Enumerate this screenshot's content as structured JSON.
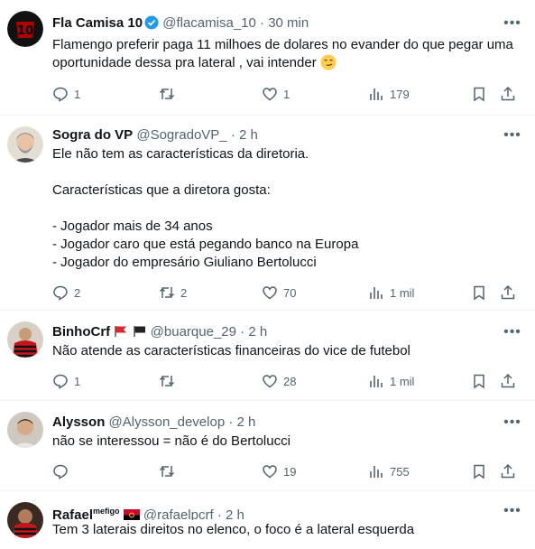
{
  "tweets": [
    {
      "name": "Fla Camisa 10",
      "handle": "@flacamisa_10",
      "time": "30 min",
      "text": "Flamengo preferir paga 11 milhoes de dolares no evander do que pegar uma oportunidade dessa pra lateral , vai intender",
      "replies": "1",
      "retweets": "",
      "likes": "1",
      "views": "179",
      "avatar_icon": "flamengo-10-logo",
      "avatar_color": "#b00000"
    },
    {
      "name": "Sogra do VP",
      "handle": "@SogradoVP_",
      "time": "2 h",
      "text": "Ele não tem as características da diretoria.\n\nCaracterísticas que a diretora gosta:\n\n- Jogador mais de 34 anos\n- Jogador caro que está pegando banco na Europa\n- Jogador do empresário Giuliano Bertolucci",
      "replies": "2",
      "retweets": "2",
      "likes": "70",
      "views": "1 mil",
      "avatar_icon": "bearded-man-photo",
      "avatar_color": "#d9d2c9"
    },
    {
      "name": "BinhoCrf",
      "handle": "@buarque_29",
      "time": "2 h",
      "text": "Não atende as características financeiras do vice de futebol",
      "replies": "1",
      "retweets": "",
      "likes": "28",
      "views": "1 mil",
      "avatar_icon": "flamengo-jersey-photo",
      "avatar_color": "#8a1010"
    },
    {
      "name": "Alysson",
      "handle": "@Alysson_develop",
      "time": "2 h",
      "text": "não se interessou = não é do Bertolucci",
      "replies": "",
      "retweets": "",
      "likes": "19",
      "views": "755",
      "avatar_icon": "man-portrait-photo",
      "avatar_color": "#cfc8c0"
    },
    {
      "name": "Rafael",
      "name_suffix": "mefigo",
      "handle": "@rafaelpcrf",
      "time": "2 h",
      "text": "Tem 3 laterais direitos no elenco, o foco é a lateral esquerda",
      "avatar_icon": "flamengo-player-photo",
      "avatar_color": "#7a1414"
    }
  ],
  "separator": "·",
  "colors": {
    "text": "#0f1419",
    "muted": "#536471",
    "verified": "#1d9bf0",
    "divider": "#eff3f4",
    "flamengo_red": "#c4161c"
  },
  "icons": [
    "reply-icon",
    "retweet-icon",
    "like-icon",
    "views-icon",
    "bookmark-icon",
    "share-icon",
    "more-icon",
    "verified-badge-icon",
    "red-flag-icon",
    "black-flag-icon",
    "angola-flag-icon",
    "smirk-emoji-icon"
  ]
}
